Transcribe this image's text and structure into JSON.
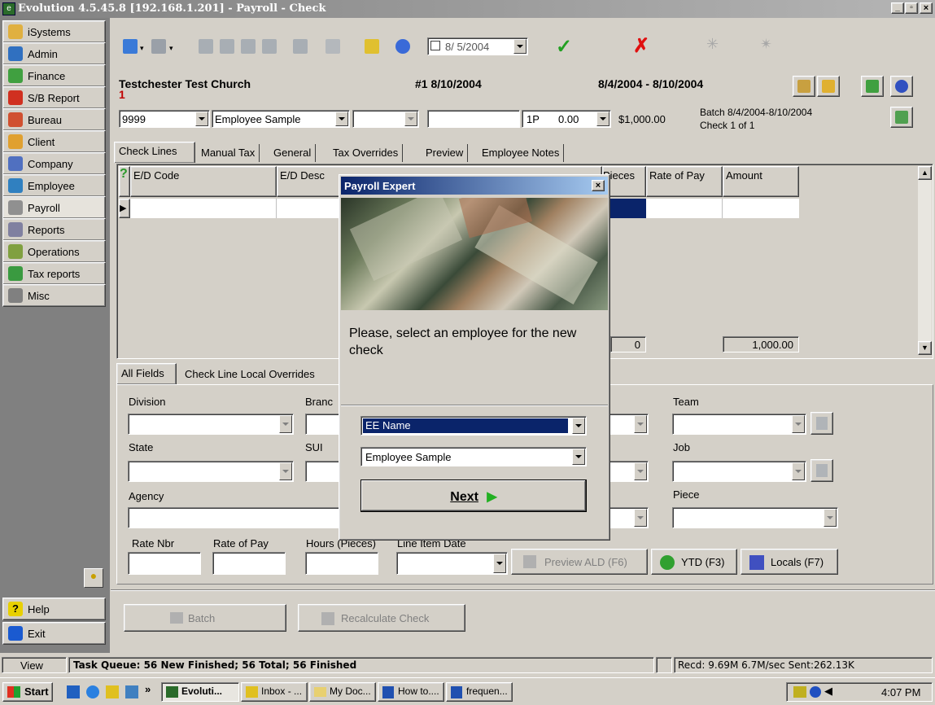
{
  "window": {
    "title": "Evolution 4.5.45.8 [192.168.1.201] - Payroll - Check"
  },
  "sidebar": {
    "items": [
      {
        "label": "iSystems",
        "icon": "systems-icon"
      },
      {
        "label": "Admin",
        "icon": "admin-icon"
      },
      {
        "label": "Finance",
        "icon": "finance-icon"
      },
      {
        "label": "S/B Report",
        "icon": "sb-report-icon"
      },
      {
        "label": "Bureau",
        "icon": "bureau-icon"
      },
      {
        "label": "Client",
        "icon": "client-icon"
      },
      {
        "label": "Company",
        "icon": "company-icon"
      },
      {
        "label": "Employee",
        "icon": "employee-icon"
      },
      {
        "label": "Payroll",
        "icon": "payroll-icon"
      },
      {
        "label": "Reports",
        "icon": "reports-icon"
      },
      {
        "label": "Operations",
        "icon": "operations-icon"
      },
      {
        "label": "Tax reports",
        "icon": "tax-reports-icon"
      },
      {
        "label": "Misc",
        "icon": "misc-icon"
      }
    ],
    "help": "Help",
    "exit": "Exit",
    "view": "View"
  },
  "toolbar": {
    "date_value": "8/ 5/2004"
  },
  "header": {
    "company": "Testchester Test Church",
    "company_num": "1",
    "payroll": "#1 8/10/2004",
    "period": "8/4/2004 - 8/10/2004",
    "ee_code": "9999",
    "ee_name": "Employee Sample",
    "rate_code": "1P",
    "rate_value": "0.00",
    "gross": "$1,000.00",
    "batch": "Batch 8/4/2004-8/10/2004",
    "check_of": "Check 1 of 1"
  },
  "tabs": [
    "Check Lines",
    "Manual Tax",
    "General",
    "Tax Overrides",
    "Preview",
    "Employee Notes"
  ],
  "grid": {
    "columns": [
      "E/D Code",
      "E/D Desc",
      "Pieces",
      "Rate of Pay",
      "Amount"
    ],
    "help_glyph": "?",
    "total_pieces": "0",
    "total_amount": "1,000.00"
  },
  "bottom_tabs": [
    "All Fields",
    "Check Line Local Overrides"
  ],
  "fields": {
    "division": "Division",
    "branch": "Branc",
    "team": "Team",
    "state": "State",
    "sui": "SUI",
    "job": "Job",
    "agency": "Agency",
    "piece": "Piece",
    "rate_nbr": "Rate Nbr",
    "rate_of_pay": "Rate of Pay",
    "hours": "Hours (Pieces)",
    "line_item_date": "Line Item Date"
  },
  "buttons": {
    "preview_ald": "Preview ALD (F6)",
    "ytd": "YTD (F3)",
    "locals": "Locals (F7)",
    "batch": "Batch",
    "recalculate": "Recalculate Check"
  },
  "dialog": {
    "title": "Payroll Expert",
    "message": "Please, select an employee for the new check",
    "lookup_field": "EE Name",
    "employee": "Employee Sample",
    "next": "Next"
  },
  "status": {
    "queue": "Task Queue: 56 New Finished; 56 Total; 56 Finished",
    "traffic": "Recd: 9.69M 6.7M/sec  Sent:262.13K"
  },
  "taskbar": {
    "start": "Start",
    "chevron": "»",
    "items": [
      "Evoluti...",
      "Inbox - ...",
      "My Doc...",
      "How to....",
      "frequen..."
    ],
    "clock": "4:07 PM"
  },
  "colors": {
    "title_bar": "#0a246a",
    "selection": "#0a246a",
    "dialog_title": "#0a246a",
    "check_green": "#22a022",
    "cancel_red": "#e01010"
  }
}
